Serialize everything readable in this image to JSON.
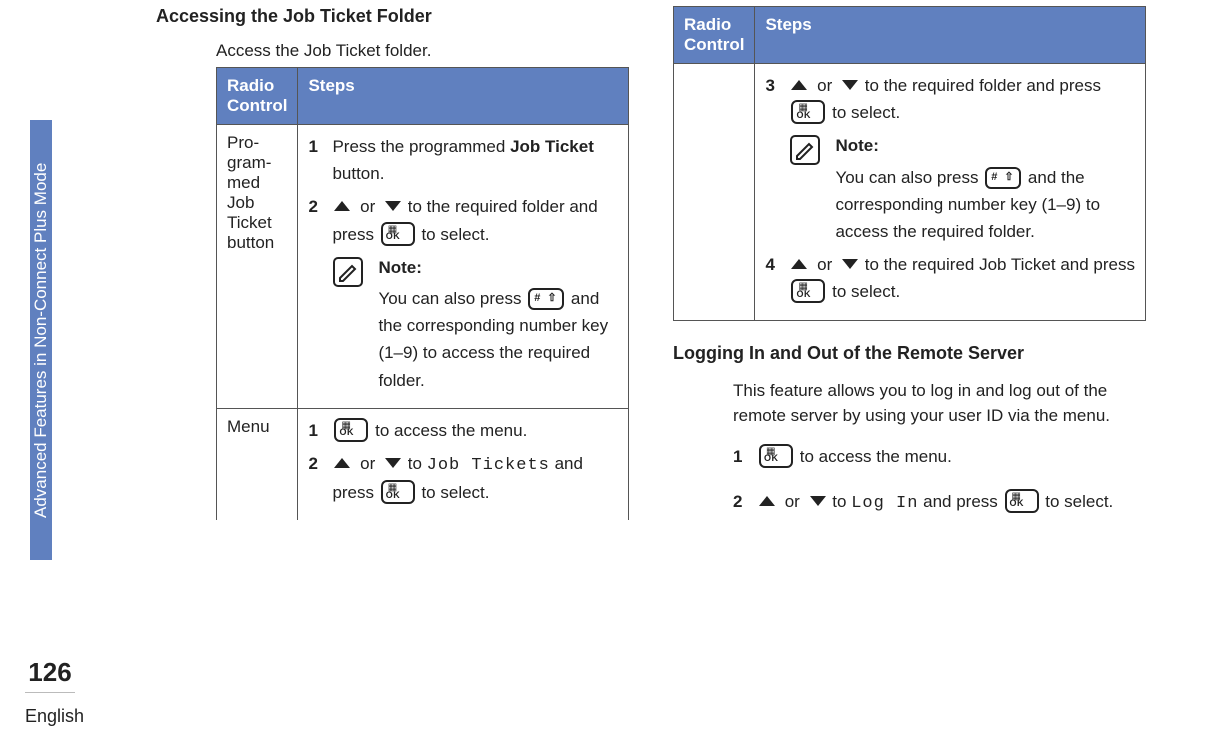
{
  "sideTab": "Advanced Features in Non-Connect Plus Mode",
  "pageNumber": "126",
  "language": "English",
  "col1": {
    "heading": "Accessing the Job Ticket Folder",
    "intro": "Access the Job Ticket folder.",
    "table": {
      "h1": "Radio Control",
      "h2": "Steps",
      "row1Label": "Pro­gram­med Job Ticket button",
      "row1": {
        "s1a": "Press the programmed ",
        "s1b": "Job Ticket",
        "s1c": " button.",
        "s2a": " or ",
        "s2b": " to the required folder and press ",
        "s2c": " to select.",
        "noteLabel": "Note:",
        "noteA": "You can also press ",
        "noteB": " and the corresponding num­ber key (1–9) to access the required folder."
      },
      "row2Label": "Menu",
      "row2": {
        "s1a": " to access the menu.",
        "s2a": " or ",
        "s2b": " to ",
        "s2mono": "Job Tickets",
        "s2c": " and press ",
        "s2d": " to select."
      }
    }
  },
  "col2": {
    "table": {
      "h1": "Radio Control",
      "h2": "Steps",
      "s3a": " or ",
      "s3b": " to the required folder and press ",
      "s3c": " to select.",
      "noteLabel": "Note:",
      "noteA": "You can also press ",
      "noteB": " and the corresponding num­ber key (1–9) to access the required folder.",
      "s4a": " or ",
      "s4b": " to the required Job Ticket and press ",
      "s4c": " to select."
    },
    "heading2": "Logging In and Out of the Remote Server",
    "intro2": "This feature allows you to log in and log out of the remote server by using your user ID via the menu.",
    "steps": {
      "s1a": " to access the menu.",
      "s2a": " or ",
      "s2b": " to ",
      "s2mono": "Log In",
      "s2c": " and press ",
      "s2d": " to select."
    }
  }
}
